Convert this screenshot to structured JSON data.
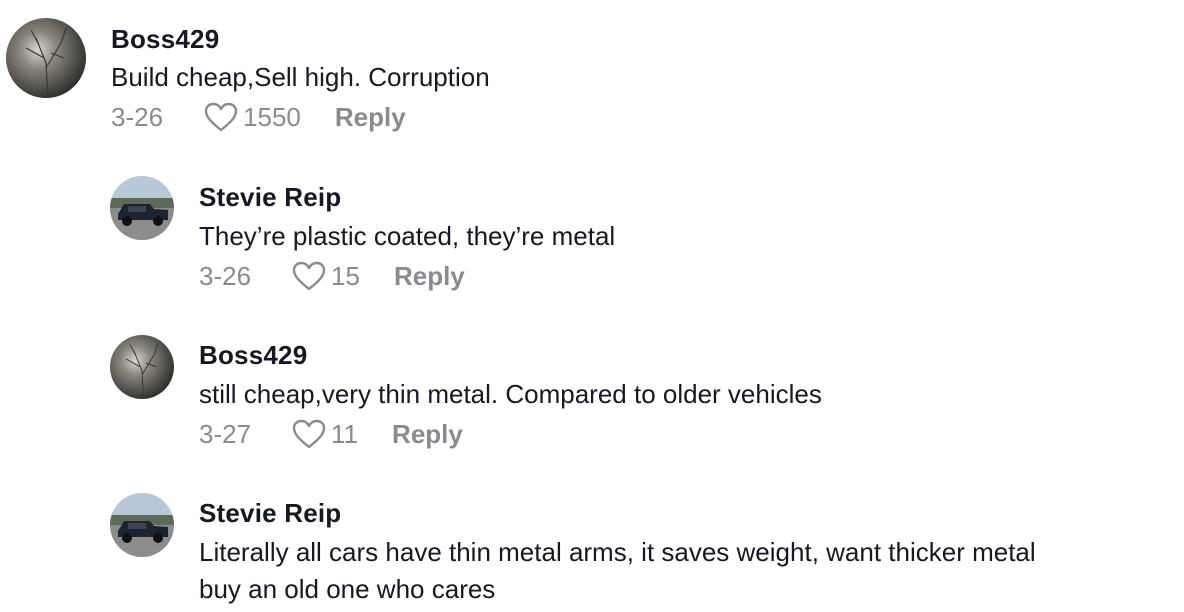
{
  "comments": [
    {
      "username": "Boss429",
      "text": "Build cheap,Sell high. Corruption",
      "date": "3-26",
      "likes": "1550",
      "reply_label": "Reply",
      "avatar_icon": "night-tree-avatar"
    },
    {
      "username": "Stevie Reip",
      "text": "They’re plastic coated, they’re metal",
      "date": "3-26",
      "likes": "15",
      "reply_label": "Reply",
      "avatar_icon": "truck-avatar"
    },
    {
      "username": "Boss429",
      "text": "still cheap,very thin metal. Compared to older vehicles",
      "date": "3-27",
      "likes": "11",
      "reply_label": "Reply",
      "avatar_icon": "night-tree-avatar"
    },
    {
      "username": "Stevie Reip",
      "text_lines": [
        "Literally all cars have thin metal arms, it saves weight, want thicker metal",
        "buy an old one who cares"
      ],
      "avatar_icon": "truck-avatar"
    }
  ],
  "colors": {
    "text": "#161823",
    "meta": "#8a8b91",
    "background": "#ffffff"
  }
}
